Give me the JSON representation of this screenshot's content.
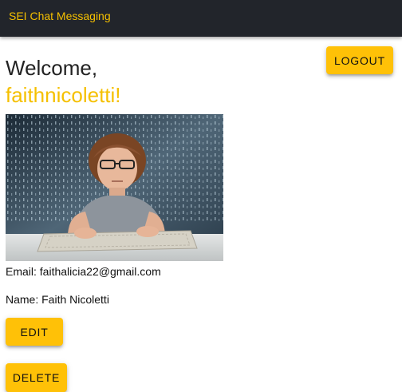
{
  "header": {
    "title": "SEI Chat Messaging"
  },
  "actions": {
    "logout_label": "Logout",
    "edit_label": "Edit",
    "delete_label": "Delete"
  },
  "profile": {
    "greeting": "Welcome,",
    "username_display": "faithnicoletti!",
    "email_label": "Email:",
    "email": "faithalicia22@gmail.com",
    "name_label": "Name:",
    "name": "Faith Nicoletti"
  },
  "colors": {
    "appbar": "#22252b",
    "accent": "#f5c000",
    "button": "#ffc107"
  }
}
